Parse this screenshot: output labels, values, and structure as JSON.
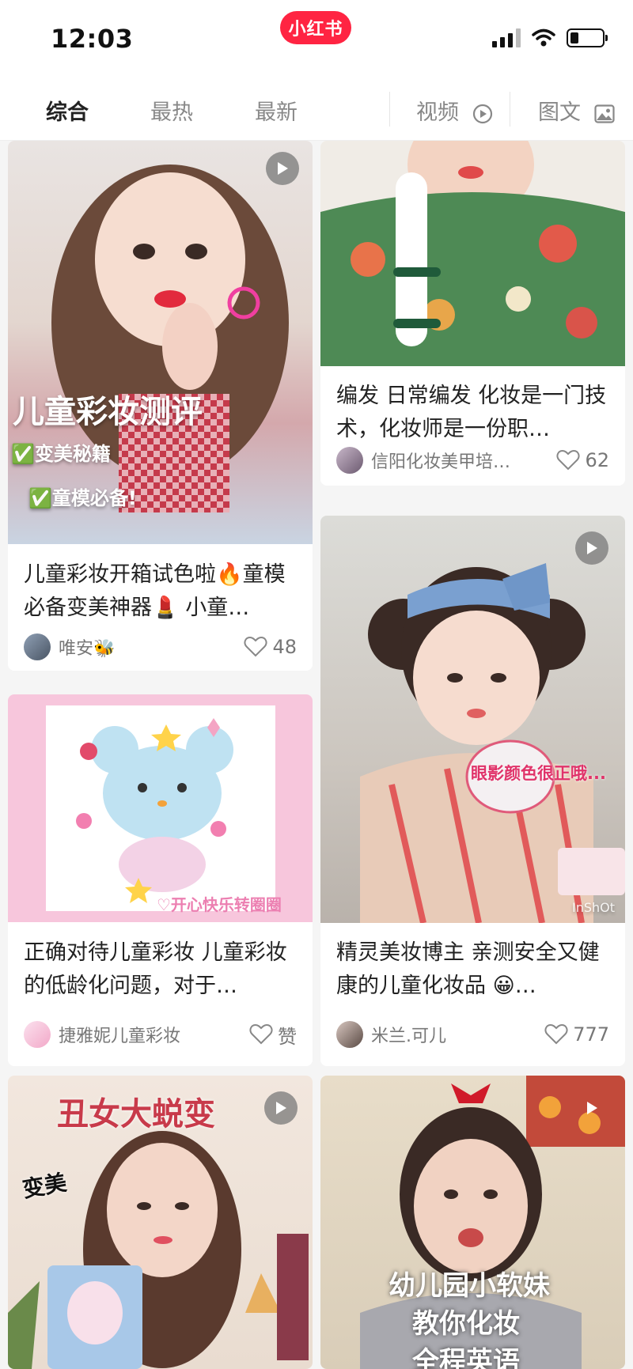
{
  "status": {
    "time": "12:03",
    "brand": "小红书"
  },
  "tabs": [
    {
      "label": "综合",
      "active": true
    },
    {
      "label": "最热",
      "active": false
    },
    {
      "label": "最新",
      "active": false
    },
    {
      "label": "视频",
      "icon": "play-circle-icon"
    },
    {
      "label": "图文",
      "icon": "image-icon"
    }
  ],
  "cards": [
    {
      "title": "儿童彩妆开箱试色啦🔥童模必备变美神器💄 小童…",
      "author": "唯安🐝",
      "likes": "48",
      "has_video": true,
      "overlay": {
        "headline": "儿童彩妆测评",
        "line1": "✅变美秘籍",
        "line2": "✅童模必备!"
      }
    },
    {
      "title": "编发 日常编发 化妆是一门技术，化妆师是一份职…",
      "author": "信阳化妆美甲培…",
      "likes": "62",
      "has_video": false
    },
    {
      "title": "正确对待儿童彩妆 儿童彩妆的低龄化问题，对于…",
      "author": "捷雅妮儿童彩妆",
      "likes": "赞",
      "has_video": false,
      "overlay": {
        "caption": "♡开心快乐转圈圈"
      }
    },
    {
      "title": "精灵美妆博主 亲测安全又健康的儿童化妆品 😀…",
      "author": "米兰.可儿",
      "likes": "777",
      "has_video": true,
      "overlay": {
        "caption": "眼影颜色很正哦...",
        "watermark": "InShOt"
      }
    },
    {
      "title": "",
      "has_video": true,
      "overlay": {
        "headline": "丑女大蜕变",
        "sticker": "变美"
      }
    },
    {
      "title": "",
      "has_video": true,
      "overlay": {
        "line1": "幼儿园小软妹",
        "line2": "教你化妆",
        "line3": "全程英语"
      }
    }
  ],
  "colors": {
    "brand": "#ff2442",
    "bg": "#f5f5f5"
  }
}
